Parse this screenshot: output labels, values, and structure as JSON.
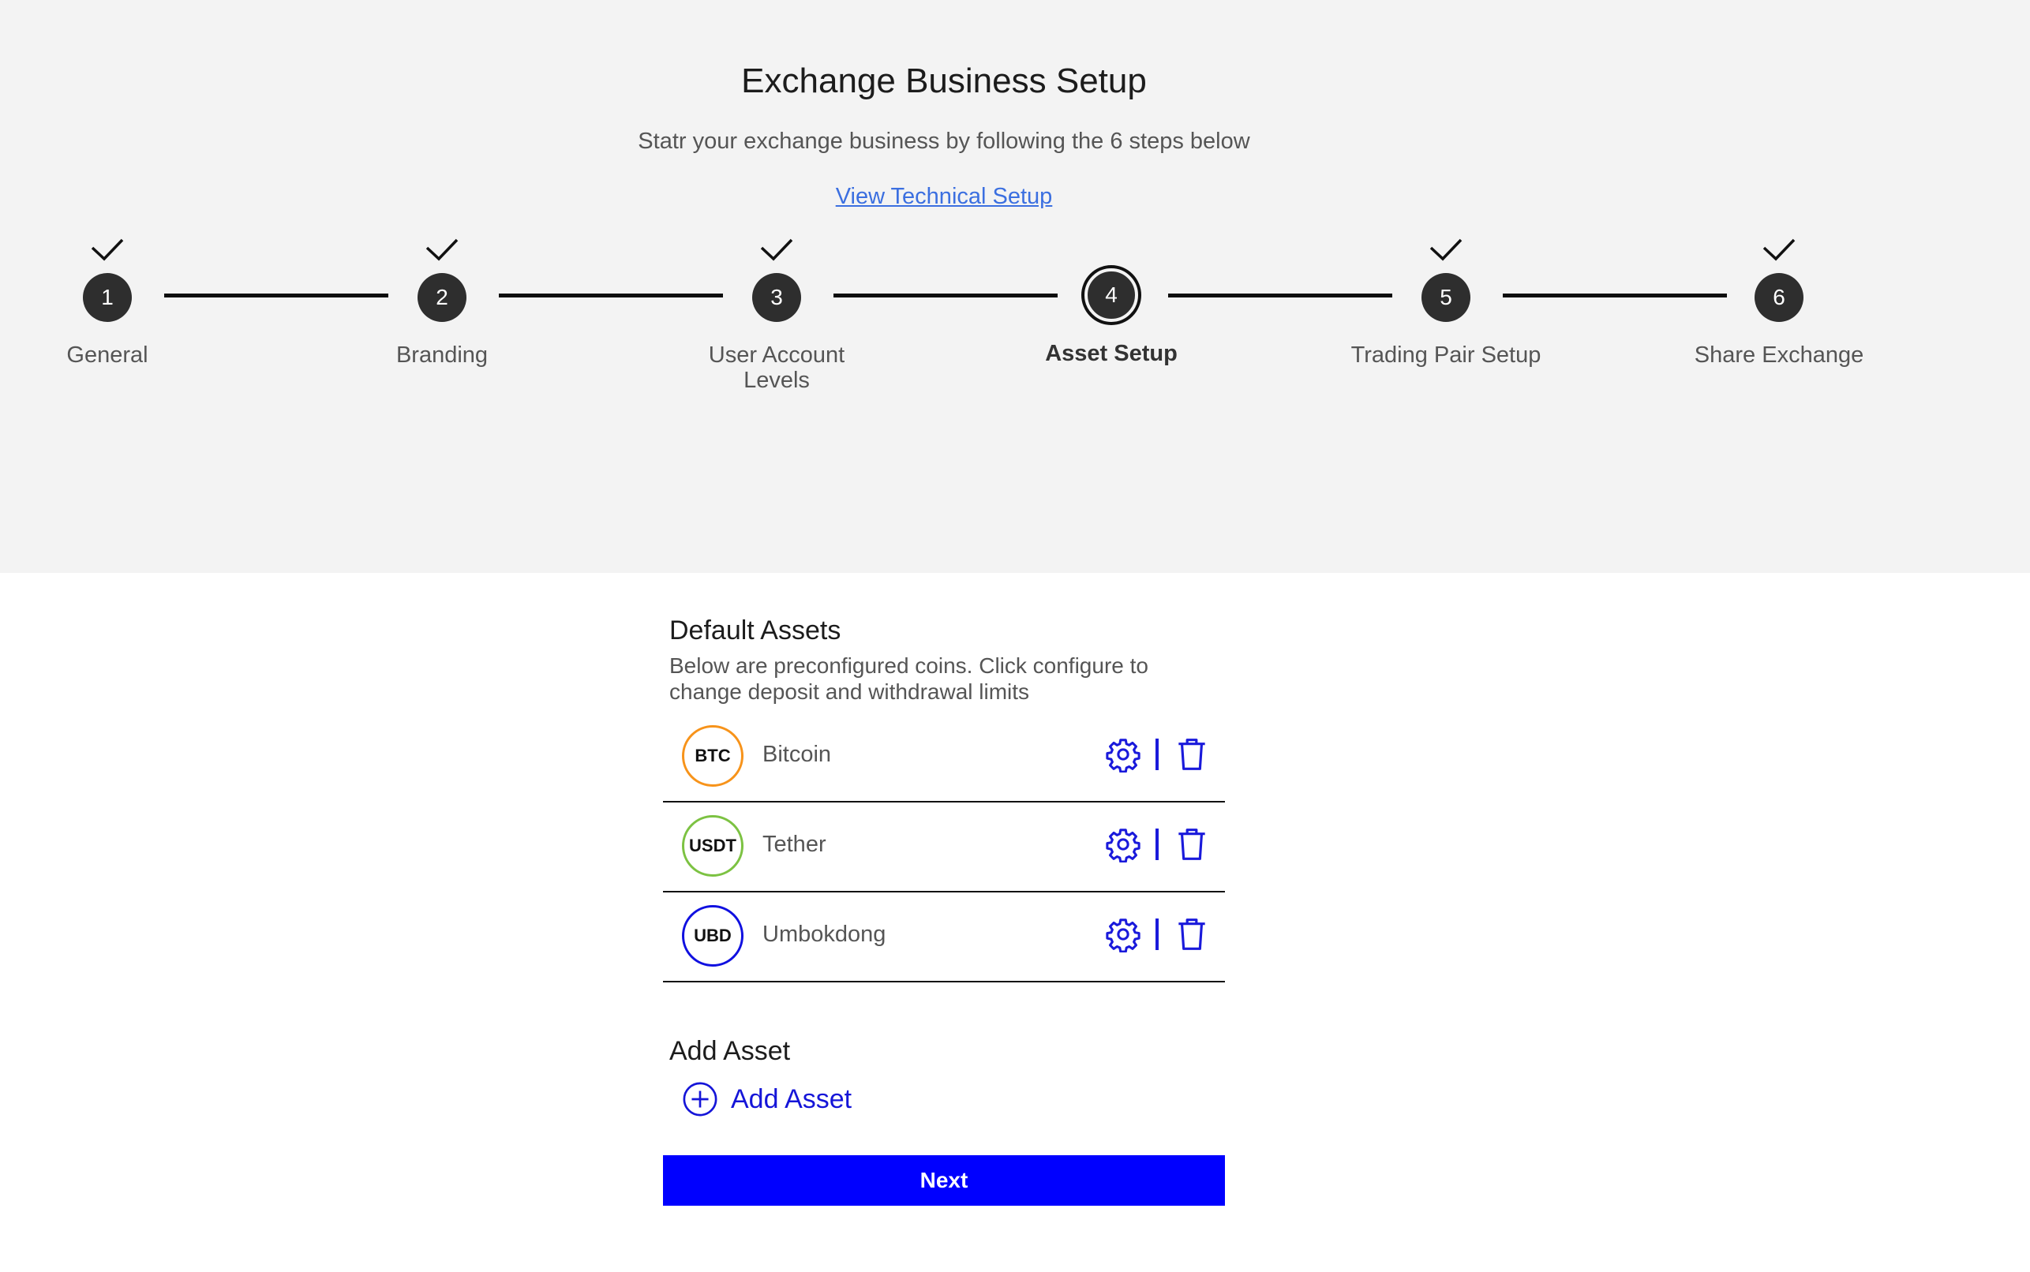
{
  "header": {
    "title": "Exchange Business Setup",
    "subtitle": "Statr your exchange business by following the 6 steps below",
    "tech_link": "View Technical Setup"
  },
  "steps": [
    {
      "number": "1",
      "label": "General",
      "completed": true,
      "active": false
    },
    {
      "number": "2",
      "label": "Branding",
      "completed": true,
      "active": false
    },
    {
      "number": "3",
      "label": "User Account Levels",
      "completed": true,
      "active": false
    },
    {
      "number": "4",
      "label": "Asset Setup",
      "completed": false,
      "active": true
    },
    {
      "number": "5",
      "label": "Trading Pair Setup",
      "completed": true,
      "active": false
    },
    {
      "number": "6",
      "label": "Share Exchange",
      "completed": true,
      "active": false
    }
  ],
  "default_assets": {
    "title": "Default Assets",
    "description": "Below are preconfigured coins. Click configure to change deposit and withdrawal limits",
    "items": [
      {
        "symbol": "BTC",
        "name": "Bitcoin",
        "color": "#f7931a"
      },
      {
        "symbol": "USDT",
        "name": "Tether",
        "color": "#7cc242"
      },
      {
        "symbol": "UBD",
        "name": "Umbokdong",
        "color": "#1010e0"
      }
    ]
  },
  "add_asset": {
    "title": "Add Asset",
    "button_label": "Add Asset"
  },
  "next_button": "Next",
  "colors": {
    "accent": "#0000ff",
    "icon_blue": "#1a1adb",
    "link": "#3b6fe0",
    "step_circle": "#2e2e2e",
    "top_background": "#f3f3f3"
  }
}
